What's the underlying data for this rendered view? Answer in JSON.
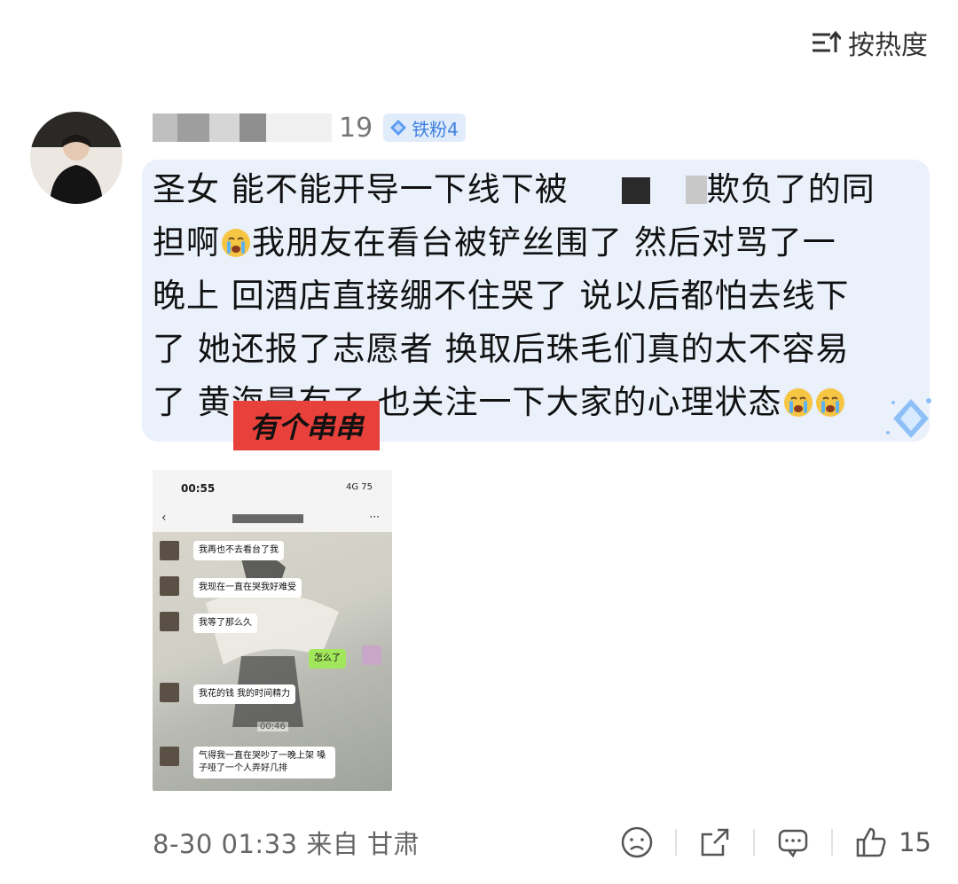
{
  "sort": {
    "label": "按热度",
    "icon": "sort-icon"
  },
  "comment": {
    "username_suffix": "19",
    "badge": {
      "label": "铁粉4",
      "icon": "diamond-icon",
      "color": "#3f7fe0"
    },
    "lines": [
      {
        "a": "圣女 能不能开导一下线下被",
        "b": "欺负了的同"
      },
      {
        "a": "担啊",
        "b": "我朋友在看台被铲丝围了 然后对骂了一"
      },
      {
        "a": "晚上 回酒店直接绷不住哭了 说以后都怕去线下"
      },
      {
        "a": "了 她还报了志愿者 换取后珠毛们真的太不容易"
      },
      {
        "a": "了 黄海是有了 也关注一下大家的心理状态"
      }
    ],
    "emoji_name": "crying-emoji",
    "watermark": "有个串串",
    "bubble_color": "#eaf1fb"
  },
  "screenshot": {
    "time": "00:55",
    "signal": "4G 75",
    "messages": [
      {
        "text": "我再也不去看台了我",
        "side": "left"
      },
      {
        "text": "我现在一直在哭我好难受",
        "side": "left"
      },
      {
        "text": "我等了那么久",
        "side": "left"
      },
      {
        "text": "怎么了",
        "side": "right"
      },
      {
        "text": "我花的钱 我的时间精力",
        "side": "left"
      },
      {
        "text": "气得我一直在哭吵了一晚上架 嗓子哑了一个人弄好几排",
        "side": "left"
      }
    ],
    "stamp": "00:46"
  },
  "footer": {
    "meta": "8-30 01:33 来自 甘肃",
    "like_count": "15",
    "icons": [
      "dislike-icon",
      "share-icon",
      "comment-icon",
      "like-icon"
    ]
  }
}
